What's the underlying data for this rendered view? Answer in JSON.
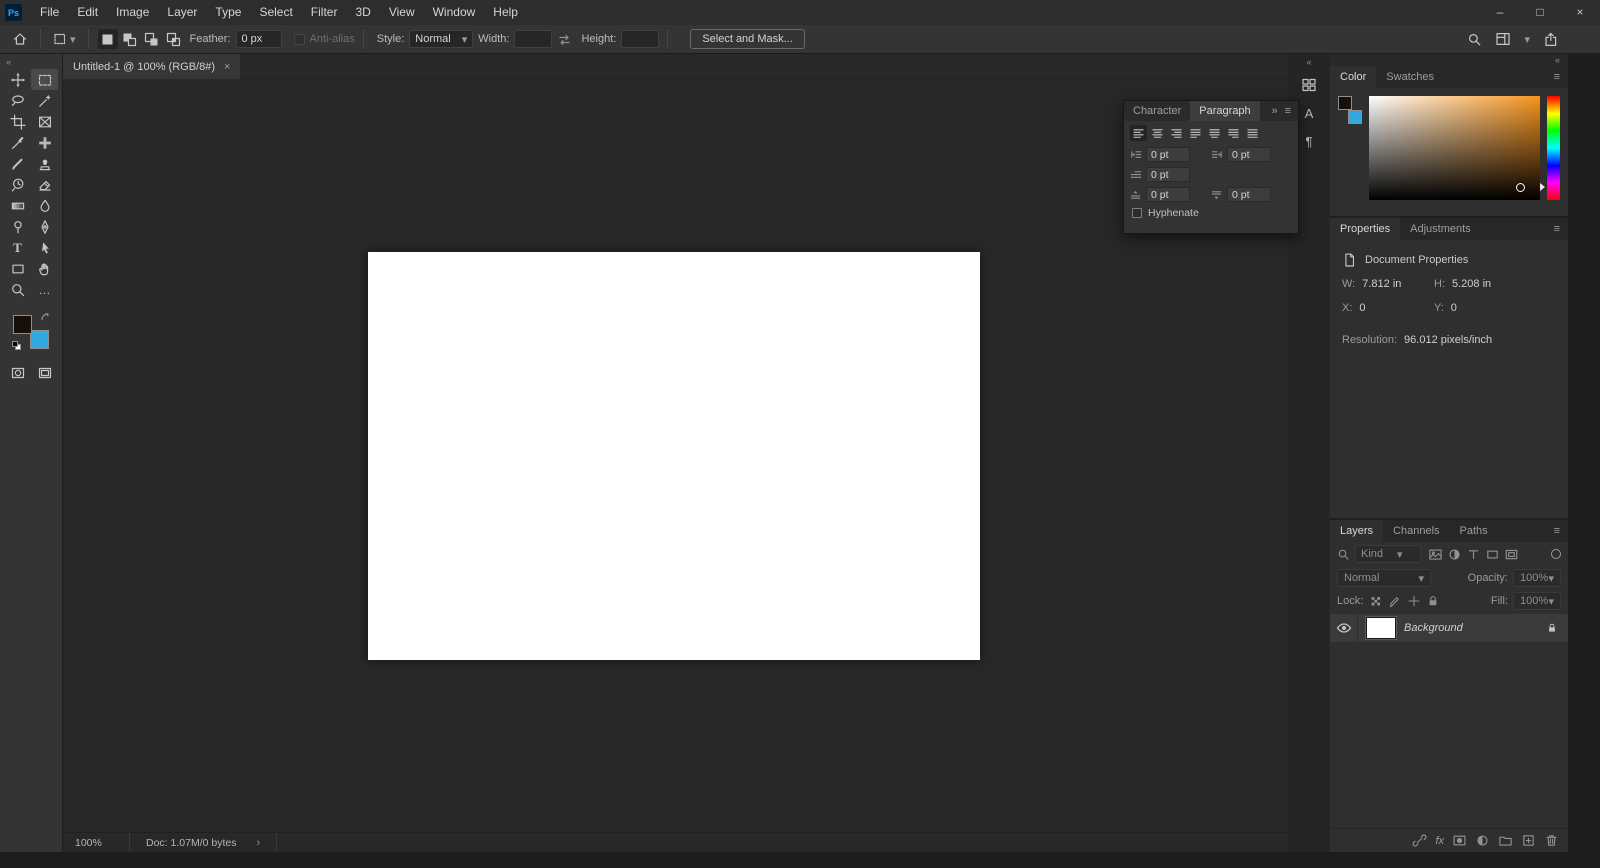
{
  "glyphs": {
    "collapse_left": "«",
    "collapse_right": "»",
    "panel_menu": "≡",
    "chevron_down": "▾",
    "chevron_right": "›",
    "close": "×",
    "minimize": "–",
    "maximize": "□",
    "ellipsis": "…",
    "character_icon": "A",
    "paragraph_icon": "¶",
    "type_tool": "T",
    "fx": "fx"
  },
  "menubar": {
    "app_icon": "Ps",
    "items": [
      "File",
      "Edit",
      "Image",
      "Layer",
      "Type",
      "Select",
      "Filter",
      "3D",
      "View",
      "Window",
      "Help"
    ]
  },
  "options_bar": {
    "feather_label": "Feather:",
    "feather_value": "0 px",
    "anti_alias_label": "Anti-alias",
    "style_label": "Style:",
    "style_value": "Normal",
    "width_label": "Width:",
    "height_label": "Height:",
    "select_and_mask": "Select and Mask..."
  },
  "document_tab": {
    "title": "Untitled-1 @ 100% (RGB/8#)"
  },
  "toolbar_tools": [
    "move",
    "rectangular-marquee",
    "lasso",
    "quick-selection",
    "crop",
    "frame",
    "eyedropper",
    "healing-brush",
    "brush",
    "clone-stamp",
    "history-brush",
    "eraser",
    "gradient",
    "blur",
    "dodge",
    "pen",
    "type",
    "path-selection",
    "rectangle",
    "hand",
    "zoom",
    "edit-toolbar"
  ],
  "colors": {
    "foreground": "#17100a",
    "background": "#31a8e0",
    "picker_hue": "#f7941d"
  },
  "paragraph_panel": {
    "tab_character": "Character",
    "tab_paragraph": "Paragraph",
    "indent_left": "0 pt",
    "indent_right": "0 pt",
    "indent_first_line": "0 pt",
    "space_before": "0 pt",
    "space_after": "0 pt",
    "hyphenate_label": "Hyphenate"
  },
  "color_panel": {
    "tab_color": "Color",
    "tab_swatches": "Swatches"
  },
  "properties_panel": {
    "tab_properties": "Properties",
    "tab_adjustments": "Adjustments",
    "section_title": "Document Properties",
    "w_label": "W:",
    "w_value": "7.812 in",
    "h_label": "H:",
    "h_value": "5.208 in",
    "x_label": "X:",
    "x_value": "0",
    "y_label": "Y:",
    "y_value": "0",
    "resolution_label": "Resolution:",
    "resolution_value": "96.012 pixels/inch"
  },
  "layers_panel": {
    "tab_layers": "Layers",
    "tab_channels": "Channels",
    "tab_paths": "Paths",
    "kind_label": "Kind",
    "blend_mode": "Normal",
    "opacity_label": "Opacity:",
    "opacity_value": "100%",
    "lock_label": "Lock:",
    "fill_label": "Fill:",
    "fill_value": "100%",
    "layers": [
      {
        "name": "Background"
      }
    ]
  },
  "status_bar": {
    "zoom": "100%",
    "doc_info": "Doc: 1.07M/0 bytes"
  }
}
